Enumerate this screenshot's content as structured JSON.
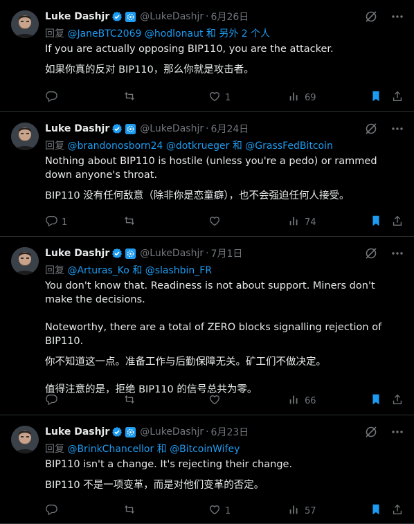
{
  "tweets": [
    {
      "name": "Luke Dashjr",
      "handle": "@LukeDashjr",
      "date": "6月26日",
      "reply_prefix": "回复",
      "reply_mentions": "@JaneBTC2069 @hodlonaut",
      "reply_suffix": "和 另外 2 个人",
      "reply_suffix_color": "#1d9bf0",
      "paragraphs": [
        "If you are actually opposing BIP110, you are the attacker.",
        "如果你真的反对 BIP110，那么你就是攻击者。"
      ],
      "replies": "",
      "retweets": "",
      "likes": "1",
      "views": "69"
    },
    {
      "name": "Luke Dashjr",
      "handle": "@LukeDashjr",
      "date": "6月24日",
      "reply_prefix": "回复",
      "reply_mentions": "@brandonosborn24 @dotkrueger",
      "reply_suffix": "和 @GrassFedBitcoin",
      "reply_suffix_color": "#1d9bf0",
      "paragraphs": [
        "Nothing about BIP110 is hostile (unless you're a pedo) or rammed down anyone's throat.",
        "BIP110 没有任何敌意（除非你是恋童癖），也不会强迫任何人接受。"
      ],
      "replies": "1",
      "retweets": "",
      "likes": "",
      "views": "74"
    },
    {
      "name": "Luke Dashjr",
      "handle": "@LukeDashjr",
      "date": "7月1日",
      "reply_prefix": "回复",
      "reply_mentions": "@Arturas_Ko",
      "reply_suffix": "和 @slashbin_FR",
      "reply_suffix_color": "#1d9bf0",
      "paragraphs": [
        "You don't know that. Readiness is not about support. Miners don't make the decisions.\n\nNoteworthy, there are a total of ZERO blocks signalling rejection of BIP110.",
        "你不知道这一点。准备工作与后勤保障无关。矿工们不做决定。\n\n值得注意的是，拒绝 BIP110 的信号总共为零。"
      ],
      "replies": "",
      "retweets": "",
      "likes": "",
      "views": "66"
    },
    {
      "name": "Luke Dashjr",
      "handle": "@LukeDashjr",
      "date": "6月23日",
      "reply_prefix": "回复",
      "reply_mentions": "@BrinkChancellor",
      "reply_suffix": "和 @BitcoinWifey",
      "reply_suffix_color": "#1d9bf0",
      "paragraphs": [
        "BIP110 isn't a change. It's rejecting their change.",
        "BIP110 不是一项变革，而是对他们变革的否定。"
      ],
      "replies": "",
      "retweets": "",
      "likes": "1",
      "views": "57"
    }
  ],
  "colors": {
    "accent": "#1d9bf0",
    "muted": "#71767b",
    "text": "#e7e9ea",
    "bg": "#000000"
  },
  "icons": [
    "grok-icon",
    "more-icon",
    "reply-icon",
    "retweet-icon",
    "like-icon",
    "views-icon",
    "bookmark-icon",
    "share-icon",
    "verified-icon",
    "affiliate-icon"
  ]
}
